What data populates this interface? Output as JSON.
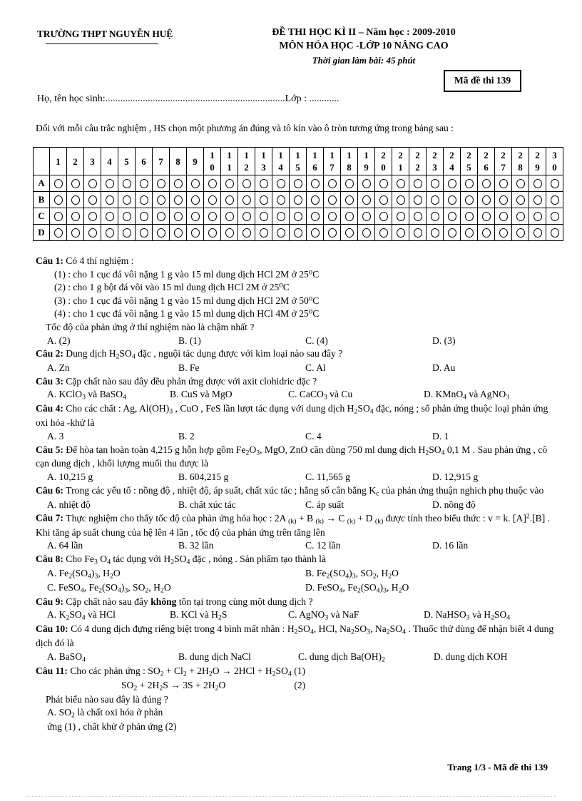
{
  "header": {
    "school_name": "TRƯỜNG THPT NGUYỄN HUỆ",
    "exam_title_line1": "ĐỀ THI HỌC KÌ II – Năm học : 2009-2010",
    "exam_title_line2": "MÔN HÓA HỌC -LỚP 10 NÂNG CAO",
    "exam_time": "Thời gian làm bài: 45 phút",
    "exam_code_box": "Mã đề thi 139"
  },
  "student_line": {
    "text": "Họ, tên học sinh:........................................................................Lớp    : ............"
  },
  "instruction": {
    "text": "Đối với mỗi câu trắc nghiệm  , HS chọn một phương  án đúng và tô kín vào ô tròn tương ứng trong bảng sau :"
  },
  "answer_grid": {
    "corner_label": "",
    "column_numbers": [
      "1",
      "2",
      "3",
      "4",
      "5",
      "6",
      "7",
      "8",
      "9",
      "10",
      "11",
      "12",
      "13",
      "14",
      "15",
      "16",
      "17",
      "18",
      "19",
      "20",
      "21",
      "22",
      "23",
      "24",
      "25",
      "26",
      "27",
      "28",
      "29",
      "30"
    ],
    "row_labels": [
      "A",
      "B",
      "C",
      "D"
    ],
    "bubble_glyph": "O"
  },
  "questions": [
    {
      "label": "Câu 1:",
      "stem": "Có 4 thí nghiệm  :",
      "sublines": [
        "(1) : cho 1 cục đá vôi nặng  1 g vào 15 ml  dung dịch HCl 2M ở 25⁰C",
        "(2) : cho 1 g bột đá vôi vào 15 ml  dung dịch  HCl 2M ở 25⁰C",
        "(3) : cho 1 cục đá vôi nặng  1 g vào 15 ml  dung dịch HCl 2M ở 50⁰C",
        "(4) : cho 1 cục đá vôi nặng  1 g vào 15 ml  dung dịch HCl 4M ở 25⁰C"
      ],
      "note": "Tốc độ của phản ứng ở thí nghiệm  nào là chậm nhất ?",
      "options": [
        "A. (2)",
        "B. (1)",
        "C. (4)",
        "D. (3)"
      ]
    },
    {
      "label": "Câu 2:",
      "stem_html": "Dung dịch H<sub>2</sub>SO<sub>4</sub> đặc , nguội tác dụng được với kim loại nào sau đây ?",
      "options": [
        "A. Zn",
        "B. Fe",
        "C. Al",
        "D. Au"
      ]
    },
    {
      "label": "Câu 3:",
      "stem_html": "Cặp chất nào sau đây đều phản ứng được với axit clohidric  đặc  ?",
      "options_html": [
        "A. KClO<sub>3</sub> và BaSO<sub>4</sub>",
        "B. CuS và MgO",
        "C. CaCO<sub>3</sub> và Cu",
        "D. KMnO<sub>4</sub> và AgNO<sub>3</sub>"
      ]
    },
    {
      "label": "Câu 4:",
      "stem_html": "Cho các chất : Ag, Al(OH)<sub>3</sub> , CuO , FeS lần lượt  tác dụng với  dung dịch H<sub>2</sub>SO<sub>4</sub> đặc, nóng ; số phản ứng thuộc loại phản ứng oxi hóa -khử là",
      "options": [
        "A. 3",
        "B. 2",
        "C. 4",
        "D. 1"
      ]
    },
    {
      "label": "Câu 5:",
      "stem_html": "Để hòa tan hoàn toàn 4,215 g hỗn hợp gồm Fe<sub>2</sub>O<sub>3</sub>, MgO, ZnO cần dùng 750 ml dung dịch H<sub>2</sub>SO<sub>4</sub> 0,1 M . Sau phản ứng , cô cạn dung dịch , khối lượng muối thu được là",
      "options": [
        "A. 10,215 g",
        "B. 604,215 g",
        "C. 11,565 g",
        "D. 12,915 g"
      ]
    },
    {
      "label": "Câu 6:",
      "stem_html": "Trong các yếu tố : nồng độ , nhiệt độ, áp suất, chất xúc tác ; hằng số cân bằng K<sub>c</sub> của phản ứng thuận nghich  phụ thuộc vào",
      "options": [
        "A. nhiệt độ",
        "B. chất xúc tác",
        "C. áp suất",
        "D. nồng độ"
      ]
    },
    {
      "label": "Câu 7:",
      "stem_html": "Thực nghiệm  cho thấy tốc độ của phản ứng hóa học : 2A <sub>(k)</sub> + B <sub>(k)</sub> → C <sub>(k)</sub>  + D <sub>(k)</sub> được tính  theo biểu thức : v = k. [A]<sup>2</sup>.[B]  . Khi tăng áp suất chung  của hệ lên 4 lần , tốc độ của phản ứng trên tăng lên",
      "options": [
        "A. 64 lần",
        "B. 32 lần",
        "C. 12 lần",
        "D. 16 lần"
      ]
    },
    {
      "label": "Câu 8:",
      "stem_html": "Cho Fe<sub>3</sub> O<sub>4</sub> tác dụng với H<sub>2</sub>SO<sub>4</sub> đặc , nóng . Sản phẩm tạo thành là",
      "options_html": [
        "A. Fe<sub>2</sub>(SO<sub>4</sub>)<sub>3</sub>, H<sub>2</sub>O",
        "B. Fe<sub>2</sub>(SO<sub>4</sub>)<sub>3</sub>, SO<sub>2</sub>, H<sub>2</sub>O",
        "C. FeSO<sub>4</sub>, Fe<sub>2</sub>(SO<sub>4</sub>)<sub>3</sub>, SO<sub>2</sub>, H<sub>2</sub>O",
        "D. FeSO<sub>4</sub>, Fe<sub>2</sub>(SO<sub>4</sub>)<sub>3</sub>, H<sub>2</sub>O"
      ]
    },
    {
      "label": "Câu 9:",
      "stem_html": "Cặp chất nào sau đây <b>không</b> tồn tại trong cùng một dung dịch ?",
      "options_html": [
        "A. K<sub>2</sub>SO<sub>4</sub> và HCl",
        "B. KCl và H<sub>2</sub>S",
        "C. AgNO<sub>3</sub> và NaF",
        "D. NaHSO<sub>3</sub> và H<sub>2</sub>SO<sub>4</sub>"
      ]
    },
    {
      "label": "Câu 10:",
      "stem_html": "Có 4 dung dịch  đựng riêng biệt trong 4 bình mất nhãn : H<sub>2</sub>SO<sub>4</sub>, HCl, Na<sub>2</sub>SO<sub>3</sub>, Na<sub>2</sub>SO<sub>4</sub> . Thuốc thử dùng để nhận biết 4 dung dịch đó là",
      "options_html": [
        "A. BaSO<sub>4</sub>",
        "B. dung dịch NaCl",
        "C. dung dịch Ba(OH)<sub>2</sub>",
        "D. dung dịch KOH"
      ]
    },
    {
      "label": "Câu 11:",
      "stem_html": "Cho các phản ứng : SO<sub>2</sub> + Cl<sub>2</sub> + 2H<sub>2</sub>O → 2HCl + H<sub>2</sub>SO<sub>4</sub>  (1)",
      "equation2_html": "SO<sub>2</sub> + 2H<sub>2</sub>S → 3S + 2H<sub>2</sub>O",
      "equation2_tag": "(2)",
      "note": "Phát biểu nào sau đây là đúng ?",
      "options_html": [
        "A. SO<sub>2</sub>  là chất oxi hóa ở phản ứng (1) , chất khử ở phản ứng (2)"
      ]
    }
  ],
  "footer": {
    "text": "Trang 1/3 - Mã đề thi 139"
  },
  "colors": {
    "page_background": "#ffffff",
    "text": "#000000",
    "rule": "#c9c9c9"
  }
}
